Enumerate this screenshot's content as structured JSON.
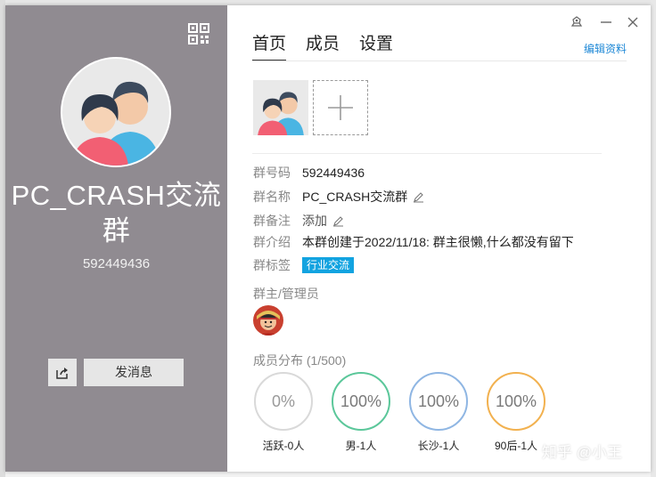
{
  "left": {
    "group_name": "PC_CRASH交流群",
    "group_id": "592449436",
    "send_message_label": "发消息"
  },
  "tabs": [
    "首页",
    "成员",
    "设置"
  ],
  "edit_profile_label": "编辑资料",
  "info": {
    "group_number": {
      "label": "群号码",
      "value": "592449436"
    },
    "group_name": {
      "label": "群名称",
      "value": "PC_CRASH交流群"
    },
    "group_remark": {
      "label": "群备注",
      "value": "添加"
    },
    "group_intro": {
      "label": "群介绍",
      "value": "本群创建于2022/11/18:  群主很懒,什么都没有留下"
    },
    "group_tag": {
      "label": "群标签",
      "value": "行业交流"
    }
  },
  "admins_title": "群主/管理员",
  "distribution": {
    "title": "成员分布 (1/500)",
    "stats": [
      {
        "value": "0%",
        "label": "活跃-0人",
        "color": "#d9d9d9",
        "text_color": "#9a9a9a"
      },
      {
        "value": "100%",
        "label": "男-1人",
        "color": "#5bc79a",
        "text_color": "#7a7a7a"
      },
      {
        "value": "100%",
        "label": "长沙-1人",
        "color": "#8fb6e3",
        "text_color": "#7a7a7a"
      },
      {
        "value": "100%",
        "label": "90后-1人",
        "color": "#f2b14f",
        "text_color": "#7a7a7a"
      }
    ]
  },
  "watermark": "知乎 @小王",
  "colors": {
    "left_panel": "#908b91",
    "tag": "#12a3e0",
    "link": "#1e88d6"
  },
  "icons": [
    "qr-code-icon",
    "share-icon",
    "pin-icon",
    "minimize-icon",
    "close-icon",
    "plus-icon",
    "pencil-icon"
  ]
}
